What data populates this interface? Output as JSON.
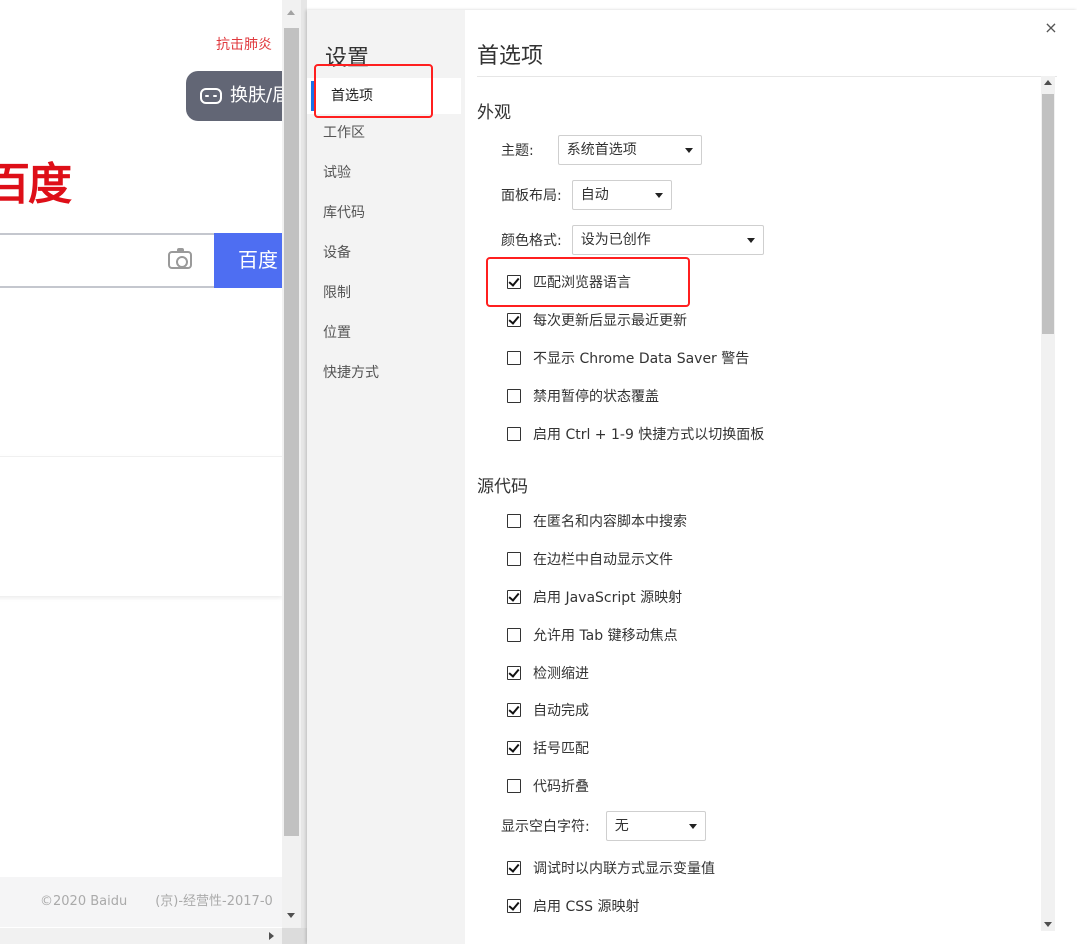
{
  "background_page": {
    "promo_text": "抗击肺炎",
    "skin_button_label": "换肤/届",
    "logo_text": "百度",
    "search_button_label": "百度",
    "footer_copyright": "©2020 Baidu",
    "footer_license": "(京)-经营性-2017-0"
  },
  "settings": {
    "dialog_title": "设置",
    "close_icon": "×",
    "sidebar": {
      "items": [
        {
          "label": "首选项",
          "active": true
        },
        {
          "label": "工作区",
          "active": false
        },
        {
          "label": "试验",
          "active": false
        },
        {
          "label": "库代码",
          "active": false
        },
        {
          "label": "设备",
          "active": false
        },
        {
          "label": "限制",
          "active": false
        },
        {
          "label": "位置",
          "active": false
        },
        {
          "label": "快捷方式",
          "active": false
        }
      ]
    },
    "main": {
      "title": "首选项",
      "appearance": {
        "section_title": "外观",
        "theme": {
          "label": "主题:",
          "value": "系统首选项"
        },
        "panel_layout": {
          "label": "面板布局:",
          "value": "自动"
        },
        "color_format": {
          "label": "颜色格式:",
          "value": "设为已创作"
        },
        "checkboxes": [
          {
            "label": "匹配浏览器语言",
            "checked": true
          },
          {
            "label": "每次更新后显示最近更新",
            "checked": true
          },
          {
            "label": "不显示 Chrome Data Saver 警告",
            "checked": false
          },
          {
            "label": "禁用暂停的状态覆盖",
            "checked": false
          },
          {
            "label": "启用 Ctrl + 1-9 快捷方式以切换面板",
            "checked": false
          }
        ]
      },
      "sources": {
        "section_title": "源代码",
        "checkboxes": [
          {
            "label": "在匿名和内容脚本中搜索",
            "checked": false
          },
          {
            "label": "在边栏中自动显示文件",
            "checked": false
          },
          {
            "label": "启用 JavaScript 源映射",
            "checked": true
          },
          {
            "label": "允许用 Tab 键移动焦点",
            "checked": false
          },
          {
            "label": "检测缩进",
            "checked": true
          },
          {
            "label": "自动完成",
            "checked": true
          },
          {
            "label": "括号匹配",
            "checked": true
          },
          {
            "label": "代码折叠",
            "checked": false
          }
        ],
        "whitespace": {
          "label": "显示空白字符:",
          "value": "无"
        },
        "more_checkboxes": [
          {
            "label": "调试时以内联方式显示变量值",
            "checked": true
          },
          {
            "label": "启用 CSS 源映射",
            "checked": true
          }
        ]
      }
    }
  },
  "colors": {
    "highlight": "#ff1f1f",
    "baidu_red": "#de0f18",
    "baidu_blue": "#4e6ef2",
    "active_accent": "#1a73e8"
  }
}
